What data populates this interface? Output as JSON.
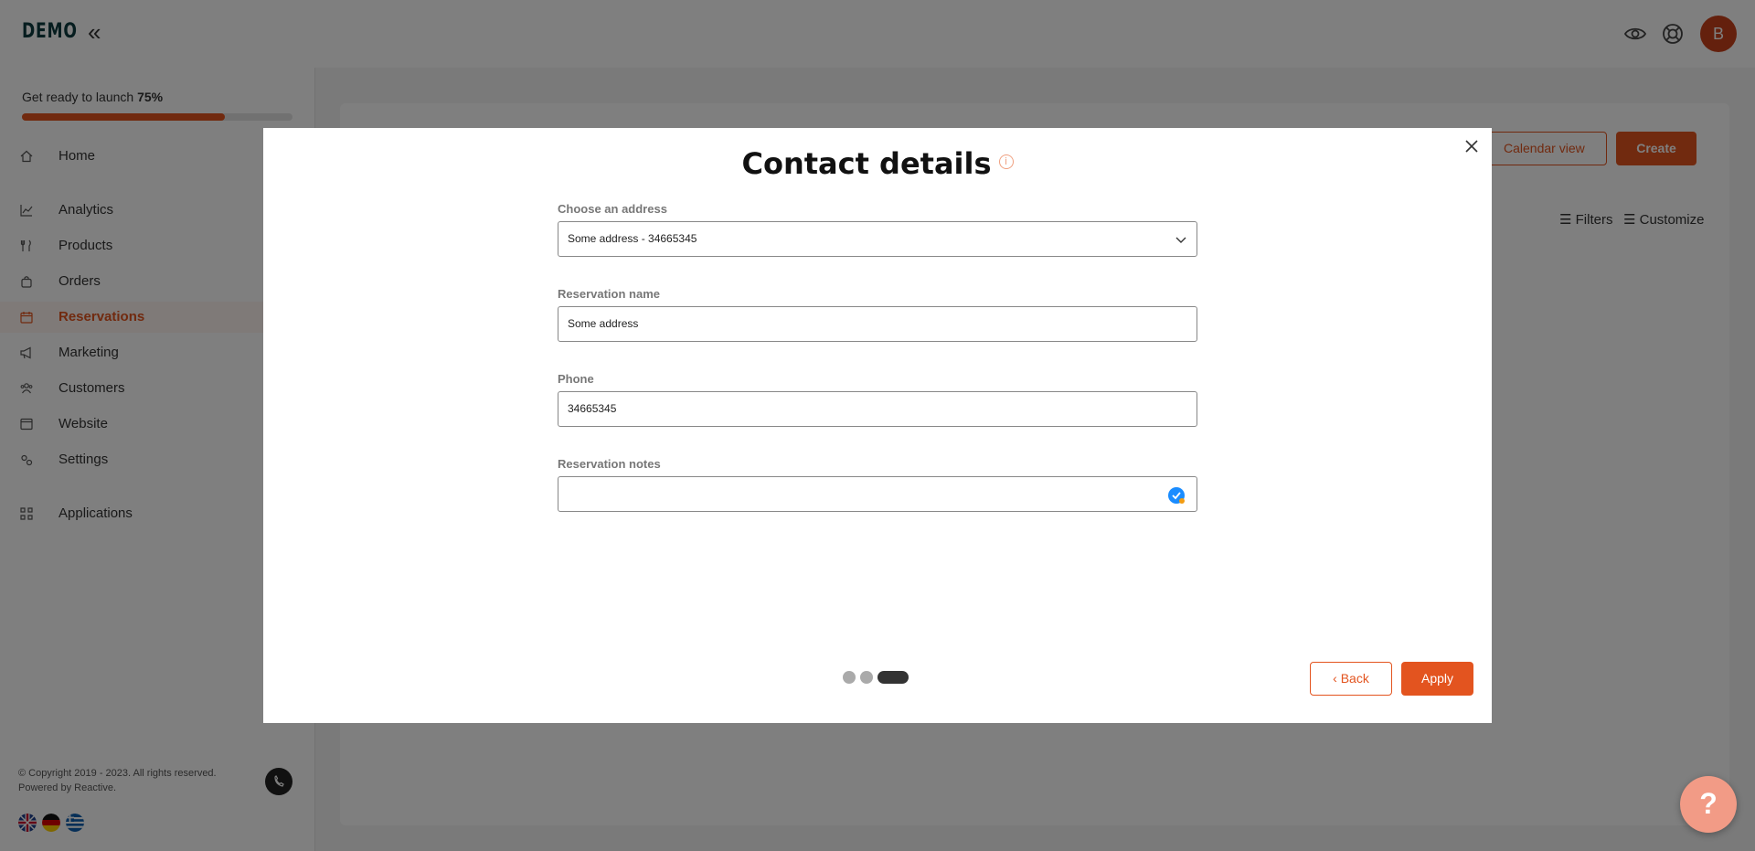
{
  "app": {
    "logo": "DEMO",
    "collapse_icon": "double-chevron-left-icon",
    "avatar_initial": "B",
    "top_icons": [
      "eye-icon",
      "lifebuoy-icon"
    ]
  },
  "sidebar": {
    "launch_text": "Get ready to launch",
    "launch_percent": "75%",
    "launch_progress": 0.75,
    "items": [
      {
        "label": "Home",
        "icon": "home-icon"
      },
      {
        "label": "Analytics",
        "icon": "chart-icon"
      },
      {
        "label": "Products",
        "icon": "cutlery-icon"
      },
      {
        "label": "Orders",
        "icon": "bag-icon"
      },
      {
        "label": "Reservations",
        "icon": "calendar-icon",
        "active": true
      },
      {
        "label": "Marketing",
        "icon": "megaphone-icon"
      },
      {
        "label": "Customers",
        "icon": "users-icon"
      },
      {
        "label": "Website",
        "icon": "browser-icon"
      },
      {
        "label": "Settings",
        "icon": "gears-icon"
      },
      {
        "label": "Applications",
        "icon": "grid-icon"
      }
    ],
    "copyright_line1": "© Copyright 2019 - 2023. All rights reserved.",
    "copyright_line2": "Powered by Reactive."
  },
  "main": {
    "calendar_view_label": "Calendar view",
    "create_label": "Create",
    "filters_label": "Filters",
    "customize_label": "Customize"
  },
  "modal": {
    "title": "Contact details",
    "info_glyph": "i",
    "address_label": "Choose an address",
    "address_value": "Some address - 34665345",
    "name_label": "Reservation name",
    "name_value": "Some address",
    "phone_label": "Phone",
    "phone_value": "34665345",
    "notes_label": "Reservation notes",
    "notes_value": "",
    "back_label": "Back",
    "apply_label": "Apply",
    "steps_total": 3,
    "step_active": 3
  },
  "help": {
    "label": "?"
  },
  "colors": {
    "accent": "#e3541f",
    "dark_teal": "#0d3b3f",
    "avatar": "#c8411a"
  }
}
